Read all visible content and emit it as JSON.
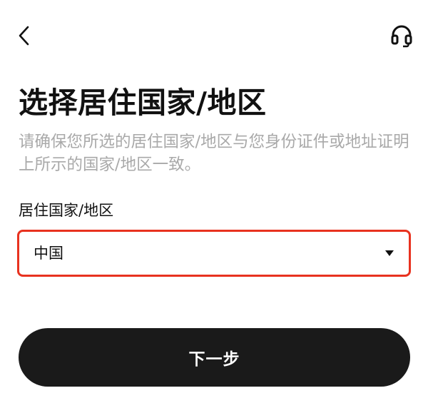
{
  "header": {
    "back_icon": "chevron-left-icon",
    "support_icon": "headset-icon"
  },
  "main": {
    "title": "选择居住国家/地区",
    "subtitle": "请确保您所选的居住国家/地区与您身份证件或地址证明上所示的国家/地区一致。",
    "field_label": "居住国家/地区",
    "select": {
      "value": "中国",
      "arrow_icon": "caret-down-icon",
      "highlight_color": "#e8321f"
    },
    "next_button_label": "下一步"
  },
  "colors": {
    "button_bg": "#1a1a1a",
    "subtitle_text": "#a9a9a9",
    "highlight_border": "#e8321f"
  }
}
